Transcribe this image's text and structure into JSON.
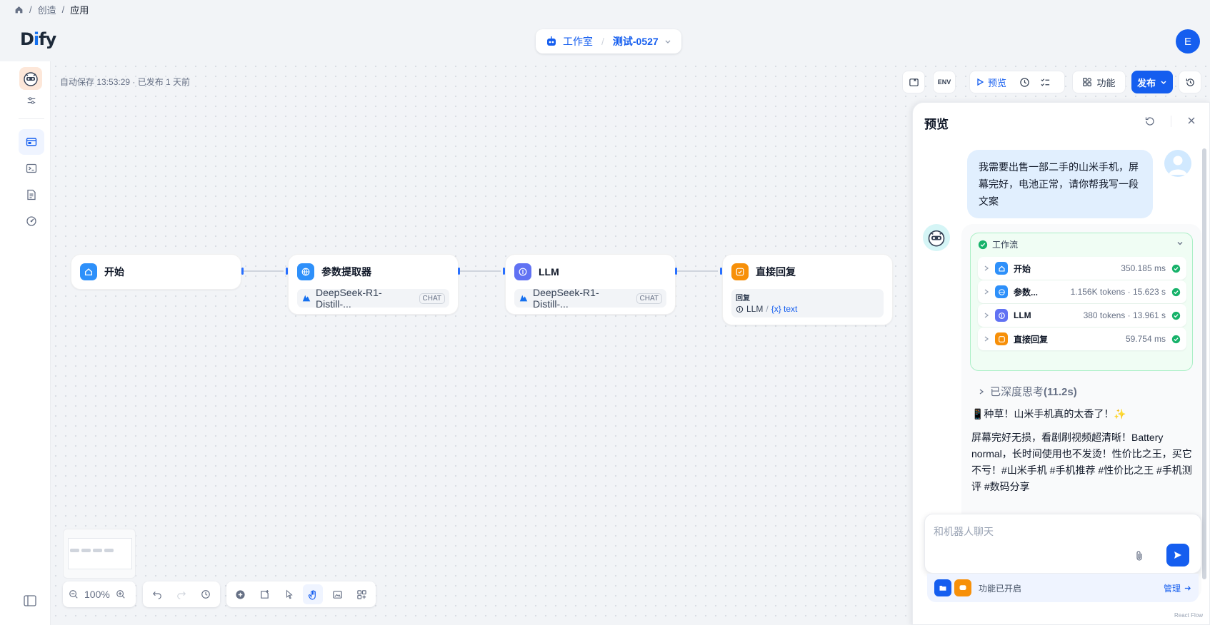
{
  "breadcrumb": {
    "home_icon": "home-icon",
    "sep": "/",
    "items": [
      "创造",
      "应用"
    ]
  },
  "header": {
    "logo": "Dify",
    "studio": "工作室",
    "sep": "/",
    "app_name": "测试-0527",
    "avatar_letter": "E"
  },
  "canvas": {
    "autosave": "自动保存 13:53:29 · 已发布 1 天前",
    "nodes": [
      {
        "title": "开始",
        "icon": "home-icon",
        "color": "#2e90fa"
      },
      {
        "title": "参数提取器",
        "icon": "globe-icon",
        "color": "#2e90fa",
        "model": "DeepSeek-R1-Distill-...",
        "chip": "CHAT"
      },
      {
        "title": "LLM",
        "icon": "brain-icon",
        "color": "#6172f3",
        "model": "DeepSeek-R1-Distill-...",
        "chip": "CHAT"
      },
      {
        "title": "直接回复",
        "icon": "reply-icon",
        "color": "#f79009",
        "reply_label": "回复",
        "reply_source": "LLM",
        "reply_var": "{x} text",
        "reply_sep": "/"
      }
    ]
  },
  "toolbar": {
    "preview": "预览",
    "features": "功能",
    "publish": "发布"
  },
  "zoom": {
    "level": "100%"
  },
  "preview_panel": {
    "title": "预览",
    "user_message": "我需要出售一部二手的山米手机，屏幕完好，电池正常，请你帮我写一段文案",
    "workflow": {
      "label": "工作流",
      "steps": [
        {
          "name": "开始",
          "meta": "350.185 ms",
          "icon": "home-icon",
          "color": "#2e90fa"
        },
        {
          "name": "参数...",
          "meta": "1.156K tokens · 15.623 s",
          "icon": "globe-icon",
          "color": "#2e90fa"
        },
        {
          "name": "LLM",
          "meta": "380 tokens · 13.961 s",
          "icon": "brain-icon",
          "color": "#6172f3"
        },
        {
          "name": "直接回复",
          "meta": "59.754 ms",
          "icon": "reply-icon",
          "color": "#f79009"
        }
      ]
    },
    "thinking": "已深度思考",
    "thinking_time": "(11.2s)",
    "answer_lines": [
      "📱种草！山米手机真的太香了！✨",
      "屏幕完好无损，看剧刷视频超清晰！Battery normal，长时间使用也不发烫！性价比之王，买它不亏！#山米手机 #手机推荐 #性价比之王 #手机测评 #数码分享"
    ],
    "input_placeholder": "和机器人聊天",
    "features_on": "功能已开启",
    "manage": "管理"
  },
  "footer": {
    "credit": "React Flow"
  }
}
